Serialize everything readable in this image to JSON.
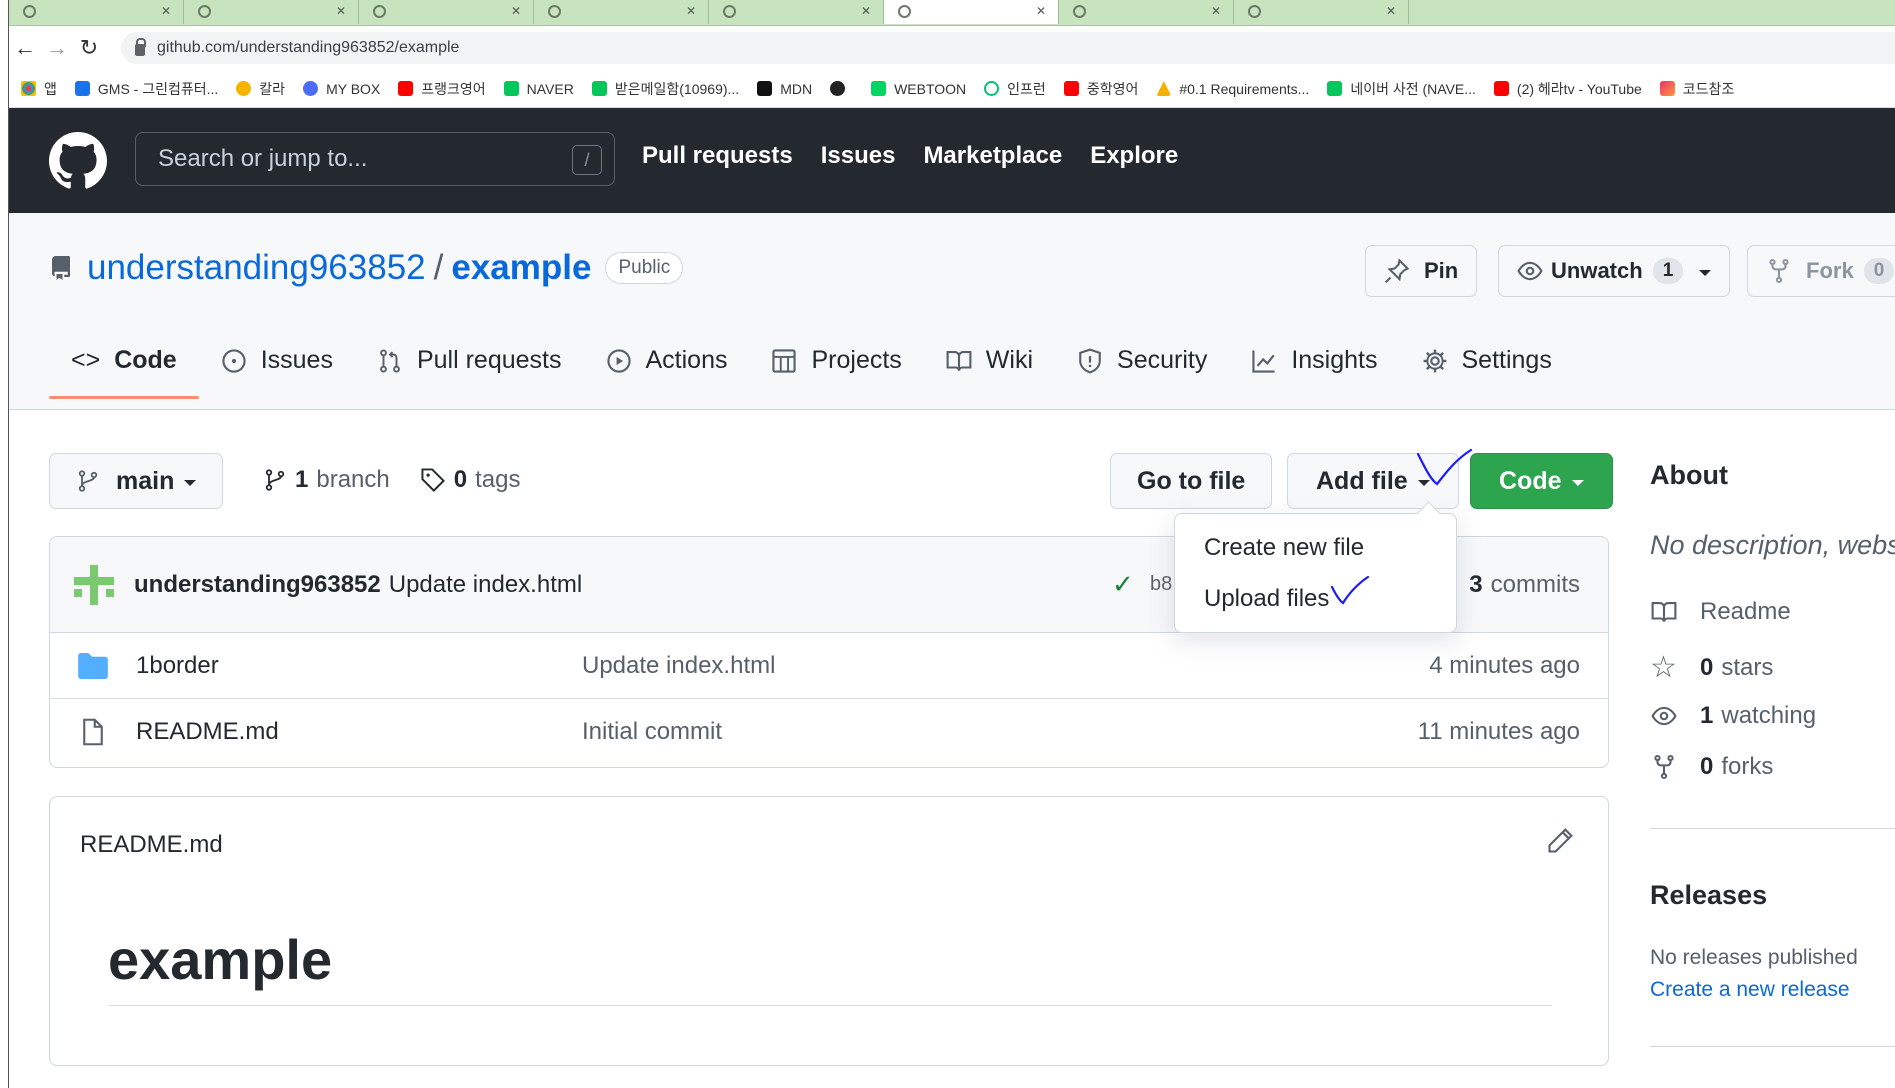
{
  "browser": {
    "url": "github.com/understanding963852/example",
    "bookmarks": [
      "앱",
      "GMS - 그린컴퓨터...",
      "칼라",
      "MY BOX",
      "프랭크영어",
      "NAVER",
      "받은메일함(10969)...",
      "MDN",
      "WEBTOON",
      "인프런",
      "중학영어",
      "#0.1 Requirements...",
      "네이버 사전 (NAVE...",
      "(2) 헤라tv - YouTube",
      "코드참조"
    ]
  },
  "header": {
    "search_placeholder": "Search or jump to...",
    "search_shortcut": "/",
    "nav": [
      "Pull requests",
      "Issues",
      "Marketplace",
      "Explore"
    ]
  },
  "repo": {
    "owner": "understanding963852",
    "separator": "/",
    "name": "example",
    "visibility": "Public",
    "pin_label": "Pin",
    "unwatch_label": "Unwatch",
    "unwatch_count": "1",
    "fork_label": "Fork",
    "fork_count": "0"
  },
  "tabs": [
    "Code",
    "Issues",
    "Pull requests",
    "Actions",
    "Projects",
    "Wiki",
    "Security",
    "Insights",
    "Settings"
  ],
  "toolbar": {
    "branch": "main",
    "branch_count": "1",
    "branch_label": "branch",
    "tag_count": "0",
    "tag_label": "tags",
    "goto_label": "Go to file",
    "add_label": "Add file",
    "code_label": "Code"
  },
  "dropdown": {
    "items": [
      "Create new file",
      "Upload files"
    ]
  },
  "commit": {
    "author": "understanding963852",
    "message": "Update index.html",
    "sha_fragment": "b8",
    "commits_count": "3",
    "commits_label": "commits"
  },
  "files": [
    {
      "name": "1border",
      "message": "Update index.html",
      "time": "4 minutes ago",
      "type": "folder"
    },
    {
      "name": "README.md",
      "message": "Initial commit",
      "time": "11 minutes ago",
      "type": "file"
    }
  ],
  "readme": {
    "filename": "README.md",
    "heading": "example"
  },
  "sidebar": {
    "about_title": "About",
    "description": "No description, webs",
    "readme_label": "Readme",
    "stars_count": "0",
    "stars_label": "stars",
    "watching_count": "1",
    "watching_label": "watching",
    "forks_count": "0",
    "forks_label": "forks",
    "releases_title": "Releases",
    "releases_none": "No releases published",
    "create_release": "Create a new release"
  },
  "colors": {
    "header_bg": "#24292f",
    "link": "#0969da",
    "green": "#2da44e",
    "tab_underline": "#fd8c73",
    "annotation_ink": "#1a1aff"
  }
}
